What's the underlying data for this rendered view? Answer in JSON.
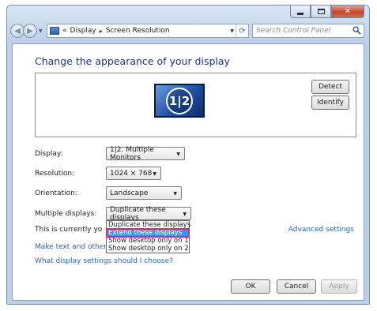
{
  "window": {
    "caption": {
      "minimize_icon": "minimize-icon",
      "maximize_icon": "maximize-icon",
      "close_glyph": "✕"
    }
  },
  "address": {
    "breadcrumbs": [
      "Display",
      "Screen Resolution"
    ],
    "overflow": "«",
    "search_placeholder": "Search Control Panel"
  },
  "main": {
    "heading": "Change the appearance of your display",
    "preview": {
      "monitor_label": "1|2",
      "detect_label": "Detect",
      "identify_label": "Identify"
    },
    "display": {
      "label": "Display:",
      "value": "1|2. Multiple Monitors"
    },
    "resolution": {
      "label": "Resolution:",
      "value": "1024 × 768"
    },
    "orientation": {
      "label": "Orientation:",
      "value": "Landscape"
    },
    "multiple": {
      "label": "Multiple displays:",
      "value": "Duplicate these displays",
      "options": [
        "Duplicate these displays",
        "Extend these displays",
        "Show desktop only on 1",
        "Show desktop only on 2"
      ],
      "highlighted_index": 1
    },
    "status_text": "This is currently yo",
    "advanced_link": "Advanced settings",
    "link_text_size": "Make text and other",
    "link_help": "What display settings should I choose?"
  },
  "footer": {
    "ok": "OK",
    "cancel": "Cancel",
    "apply": "Apply"
  },
  "colors": {
    "heading": "#1e3287",
    "link": "#2a66b5",
    "highlight": "#3399ff",
    "highlight_outline": "#e0267a"
  }
}
